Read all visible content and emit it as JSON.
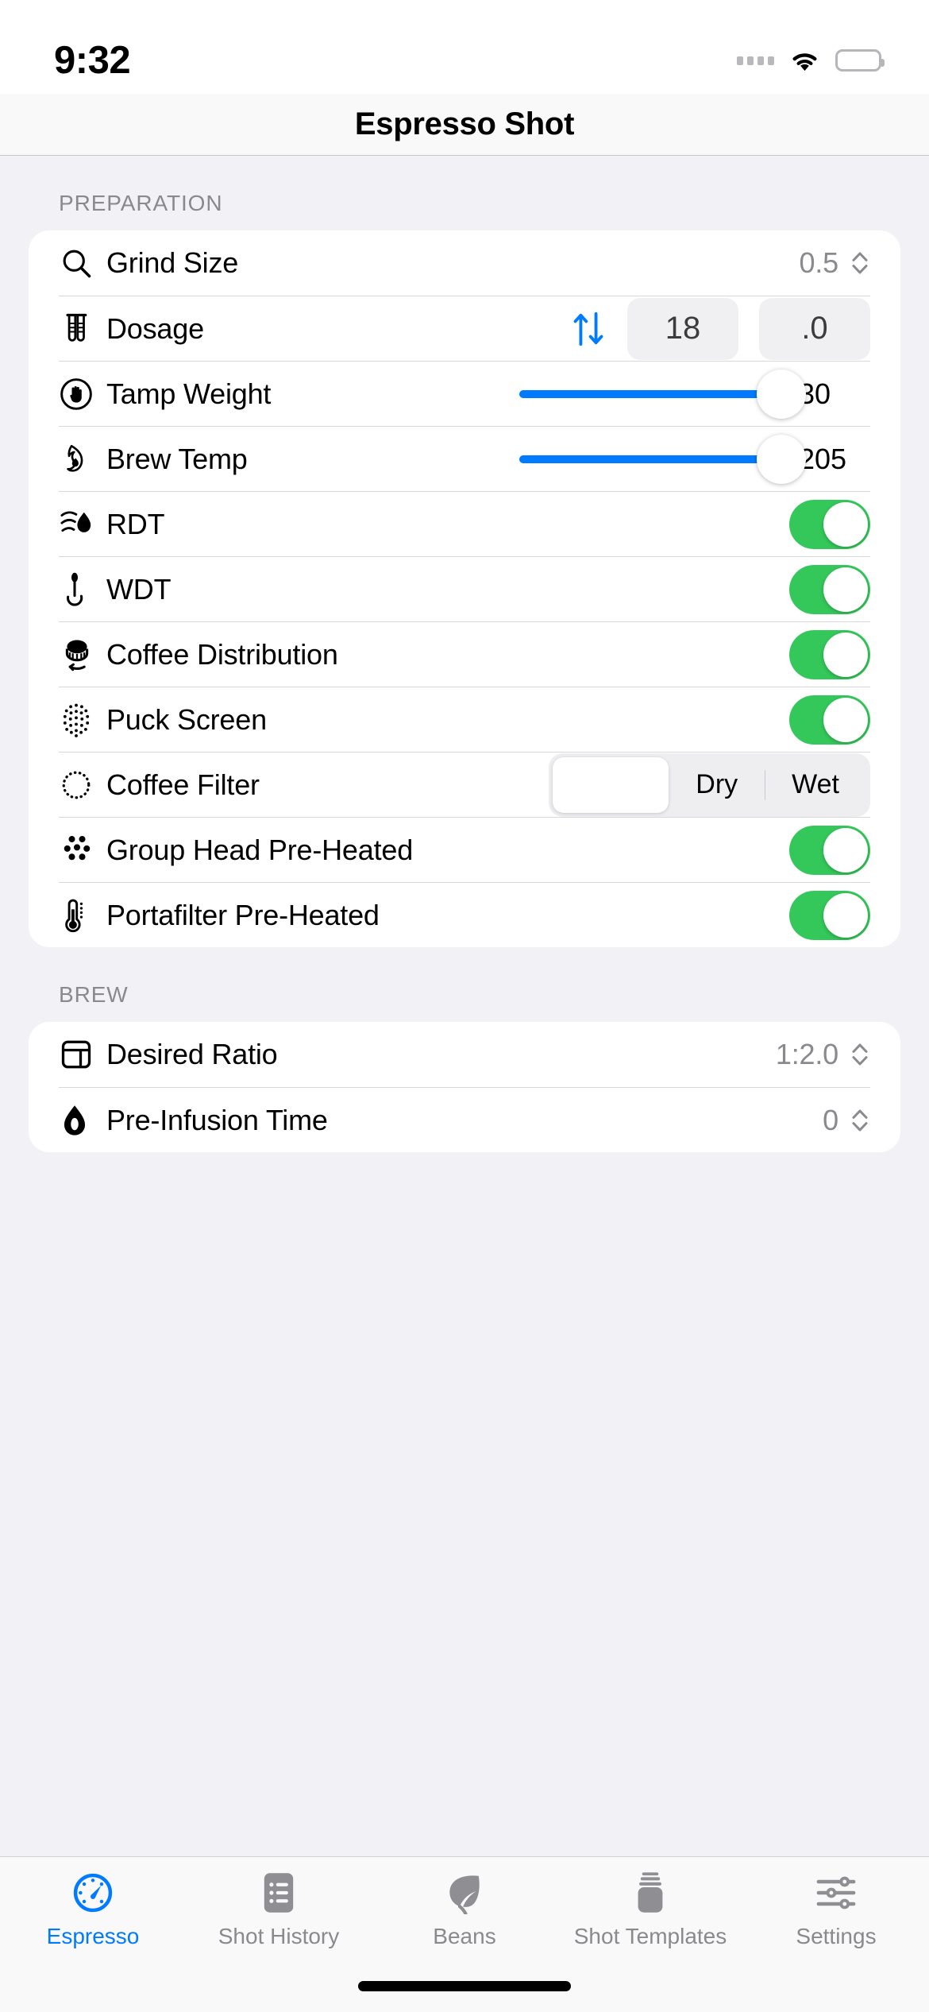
{
  "status_bar": {
    "time": "9:32",
    "signal_icon": "signal-dots-icon",
    "wifi_icon": "wifi-icon",
    "battery_icon": "battery-icon"
  },
  "nav": {
    "title": "Espresso Shot"
  },
  "sections": [
    {
      "header": "PREPARATION",
      "rows": [
        {
          "icon": "magnifying-glass-icon",
          "label": "Grind Size",
          "type": "stepper",
          "value": "0.5"
        },
        {
          "icon": "test-tubes-icon",
          "label": "Dosage",
          "type": "dosage",
          "whole": "18",
          "fraction": ".0"
        },
        {
          "icon": "hand-tamp-icon",
          "label": "Tamp Weight",
          "type": "slider",
          "value": "30",
          "percent": 100
        },
        {
          "icon": "flame-drop-icon",
          "label": "Brew Temp",
          "type": "slider",
          "value": "205",
          "percent": 100
        },
        {
          "icon": "water-spray-icon",
          "label": "RDT",
          "type": "toggle",
          "on": true
        },
        {
          "icon": "needle-pin-icon",
          "label": "WDT",
          "type": "toggle",
          "on": true
        },
        {
          "icon": "puck-distribution-icon",
          "label": "Coffee Distribution",
          "type": "toggle",
          "on": true
        },
        {
          "icon": "puck-screen-dots-icon",
          "label": "Puck Screen",
          "type": "toggle",
          "on": true
        },
        {
          "icon": "dotted-circle-icon",
          "label": "Coffee Filter",
          "type": "segmented",
          "options": [
            "",
            "Dry",
            "Wet"
          ],
          "selected_index": 0
        },
        {
          "icon": "shower-head-icon",
          "label": "Group Head Pre-Heated",
          "type": "toggle",
          "on": true
        },
        {
          "icon": "thermometer-icon",
          "label": "Portafilter Pre-Heated",
          "type": "toggle",
          "on": true
        }
      ]
    },
    {
      "header": "BREW",
      "rows": [
        {
          "icon": "ratio-layout-icon",
          "label": "Desired Ratio",
          "type": "stepper",
          "value": "1:2.0"
        },
        {
          "icon": "water-drop-icon",
          "label": "Pre-Infusion Time",
          "type": "stepper",
          "value": "0"
        }
      ]
    }
  ],
  "tabbar": {
    "tabs": [
      {
        "icon": "gauge-icon",
        "label": "Espresso",
        "active": true
      },
      {
        "icon": "list-doc-icon",
        "label": "Shot History",
        "active": false
      },
      {
        "icon": "leaf-icon",
        "label": "Beans",
        "active": false
      },
      {
        "icon": "jar-icon",
        "label": "Shot Templates",
        "active": false
      },
      {
        "icon": "sliders-icon",
        "label": "Settings",
        "active": false
      }
    ]
  },
  "colors": {
    "accent_blue": "#007aff",
    "toggle_green": "#34c759",
    "secondary_text": "#8a8a8e",
    "group_background": "#f1f1f6"
  }
}
